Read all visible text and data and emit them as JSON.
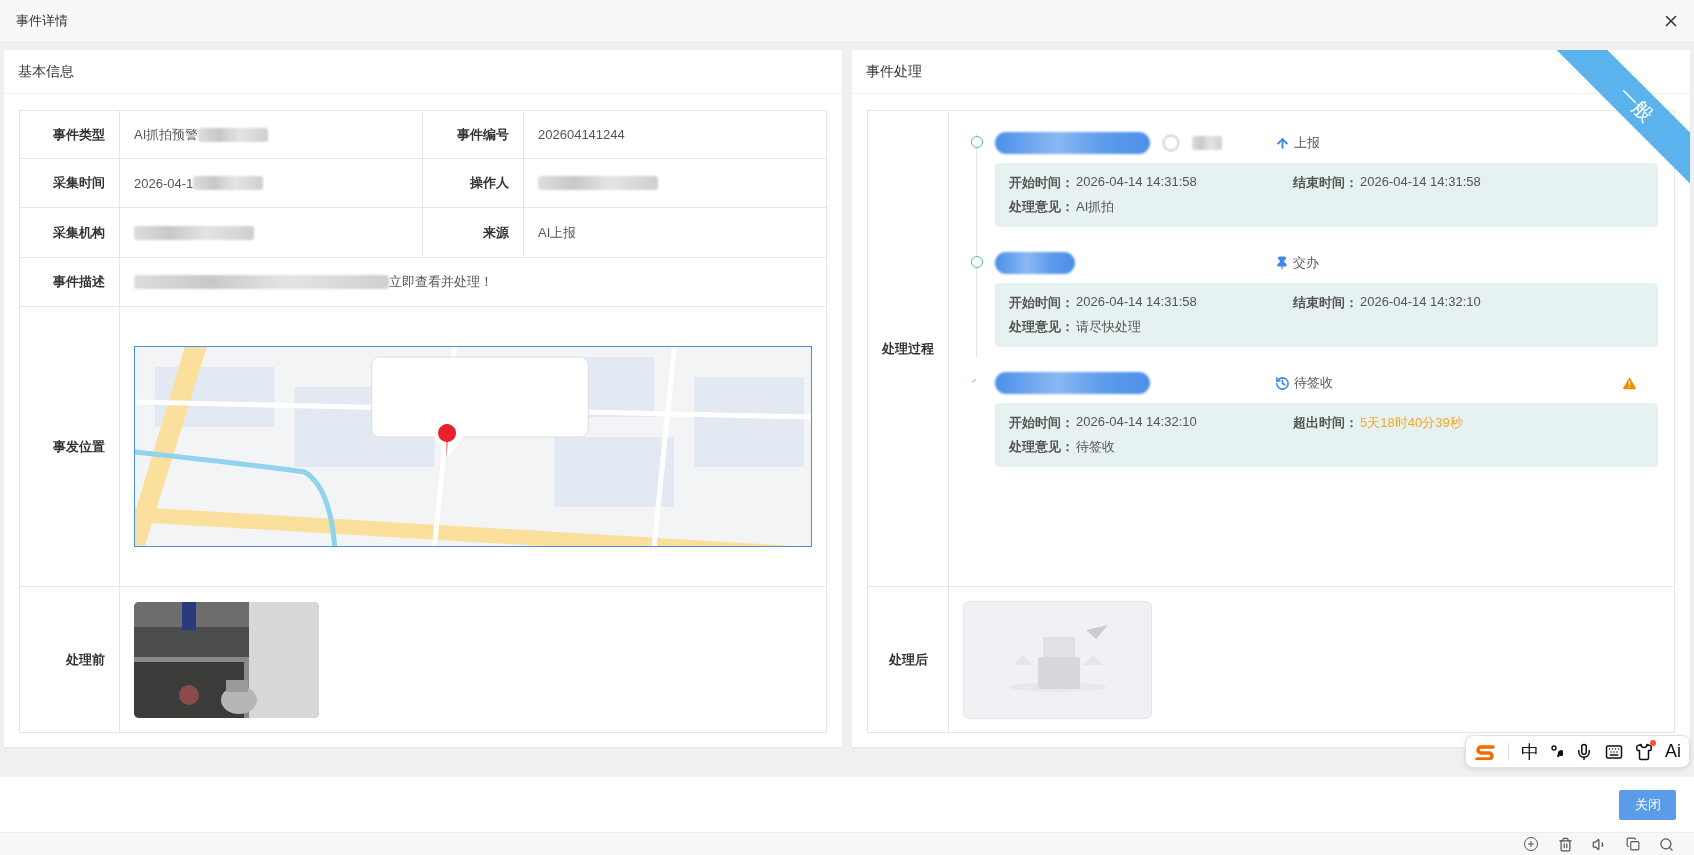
{
  "dialog": {
    "title": "事件详情"
  },
  "basic": {
    "title": "基本信息",
    "rows": [
      [
        {
          "label": "事件类型",
          "value": "AI抓拍预警",
          "kind": "after"
        },
        {
          "label": "事件编号",
          "value": "202604141244",
          "kind": "plain"
        }
      ],
      [
        {
          "label": "采集时间",
          "value": "2026-04-1",
          "kind": "after"
        },
        {
          "label": "操作人",
          "kind": "whole"
        }
      ],
      [
        {
          "label": "采集机构",
          "kind": "whole"
        },
        {
          "label": "来源",
          "value": "AI上报",
          "kind": "plain"
        }
      ],
      [
        {
          "label": "事件描述",
          "value": "立即查看并处理！",
          "kind": "before"
        }
      ]
    ],
    "location": {
      "label": "事发位置",
      "kind": "picture"
    },
    "before": {
      "label": "处理前",
      "kind": "picture"
    }
  },
  "processing": {
    "title": "事件处理",
    "priority": "一般",
    "process_label": "处理过程",
    "after": {
      "label": "处理后",
      "kind": "placeholder"
    },
    "steps": [
      {
        "action": "上报",
        "kind": "up",
        "avatar": true,
        "warning": false,
        "fields": [
          {
            "label": "开始时间：",
            "value": "2026-04-14 14:31:58",
            "alert": false
          },
          {
            "label": "结束时间：",
            "value": "2026-04-14 14:31:58",
            "alert": false
          },
          {
            "label": "处理意见：",
            "value": "AI抓拍",
            "alert": false
          }
        ]
      },
      {
        "action": "交办",
        "kind": "pin",
        "avatar": false,
        "warning": false,
        "fields": [
          {
            "label": "开始时间：",
            "value": "2026-04-14 14:31:58",
            "alert": false
          },
          {
            "label": "结束时间：",
            "value": "2026-04-14 14:32:10",
            "alert": false
          },
          {
            "label": "处理意见：",
            "value": "请尽快处理",
            "alert": false
          }
        ]
      },
      {
        "action": "待签收",
        "kind": "history",
        "avatar": false,
        "warning": true,
        "fields": [
          {
            "label": "开始时间：",
            "value": "2026-04-14 14:32:10",
            "alert": false
          },
          {
            "label": "超出时间：",
            "value": "5天18时40分39秒",
            "alert": true
          },
          {
            "label": "处理意见：",
            "value": "待签收",
            "alert": false
          }
        ]
      }
    ]
  },
  "footer": {
    "close_button": "关闭"
  },
  "ime": {
    "mode": "中",
    "ai": "Ai",
    "notification": true
  }
}
